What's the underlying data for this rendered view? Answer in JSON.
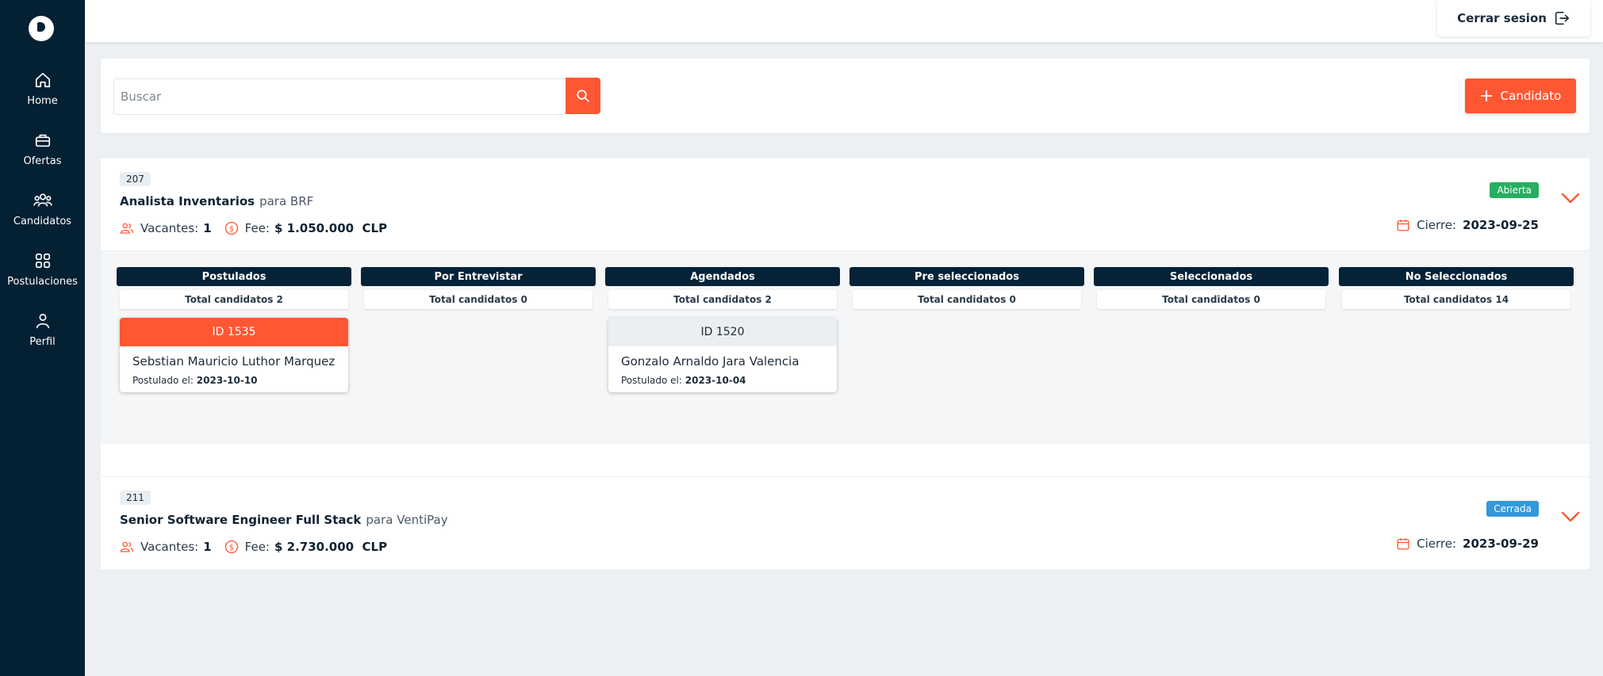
{
  "sidebar": {
    "items": [
      {
        "label": "Home",
        "icon": "home-icon"
      },
      {
        "label": "Ofertas",
        "icon": "briefcase-icon"
      },
      {
        "label": "Candidatos",
        "icon": "users-icon"
      },
      {
        "label": "Postulaciones",
        "icon": "grid-icon"
      },
      {
        "label": "Perfil",
        "icon": "user-icon"
      }
    ]
  },
  "topbar": {
    "logout_label": "Cerrar sesion"
  },
  "search": {
    "placeholder": "Buscar",
    "add_label": "Candidato"
  },
  "colors": {
    "accent": "#ff5733",
    "sidebar": "#042033",
    "open": "#27ae60",
    "closed": "#3498db"
  },
  "jobs": [
    {
      "id": "207",
      "title": "Analista Inventarios",
      "company": "para BRF",
      "vacantes_label": "Vacantes:",
      "vacantes": "1",
      "fee_label": "Fee:",
      "fee": "$ 1.050.000  CLP",
      "status": "Abierta",
      "closing_label": "Cierre:",
      "closing_date": "2023-09-25",
      "columns": [
        {
          "title": "Postulados",
          "total": "Total candidatos 2"
        },
        {
          "title": "Por Entrevistar",
          "total": "Total candidatos 0"
        },
        {
          "title": "Agendados",
          "total": "Total candidatos 2"
        },
        {
          "title": "Pre seleccionados",
          "total": "Total candidatos 0"
        },
        {
          "title": "Seleccionados",
          "total": "Total candidatos 0"
        },
        {
          "title": "No Seleccionados",
          "total": "Total candidatos 14"
        }
      ],
      "cards": [
        {
          "id_label": "ID 1535",
          "name": "Sebstian Mauricio Luthor Marquez",
          "date_label": "Postulado el:",
          "date": "2023-10-10"
        },
        {
          "id_label": "ID 1520",
          "name": "Gonzalo Arnaldo Jara Valencia",
          "date_label": "Postulado el:",
          "date": "2023-10-04"
        }
      ]
    },
    {
      "id": "211",
      "title": "Senior Software Engineer Full Stack",
      "company": "para VentiPay",
      "vacantes_label": "Vacantes:",
      "vacantes": "1",
      "fee_label": "Fee:",
      "fee": "$ 2.730.000  CLP",
      "status": "Cerrada",
      "closing_label": "Cierre:",
      "closing_date": "2023-09-29"
    }
  ]
}
